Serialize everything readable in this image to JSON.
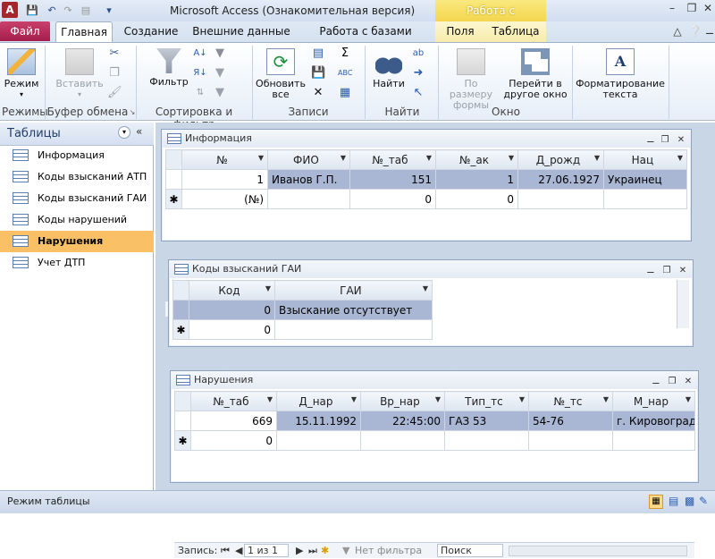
{
  "app": {
    "window_title": "Microsoft Access (Ознакомительная версия)",
    "context_group": "Работа с таблицами"
  },
  "ribbon_tabs": [
    "Файл",
    "Главная",
    "Создание",
    "Внешние данные",
    "Работа с базами данных",
    "Поля",
    "Таблица"
  ],
  "ribbon": {
    "views": {
      "mode": "Режим",
      "group": "Режимы"
    },
    "clipboard": {
      "paste": "Вставить",
      "group": "Буфер обмена"
    },
    "sort": {
      "filter": "Фильтр",
      "group": "Сортировка и фильтр"
    },
    "records": {
      "refresh_line1": "Обновить",
      "refresh_line2": "все",
      "group": "Записи"
    },
    "find": {
      "find": "Найти",
      "group": "Найти"
    },
    "window": {
      "fit_line1": "По размеру",
      "fit_line2": "формы",
      "switch_line1": "Перейти в",
      "switch_line2": "другое окно",
      "group": "Окно"
    },
    "text": {
      "format_line1": "Форматирование",
      "format_line2": "текста"
    }
  },
  "nav": {
    "title": "Таблицы",
    "items": [
      "Информация",
      "Коды взысканий АТП",
      "Коды взысканий ГАИ",
      "Коды нарушений",
      "Нарушения",
      "Учет ДТП"
    ],
    "selected": "Нарушения"
  },
  "recbar": {
    "label": "Запись:",
    "position": "1 из 1",
    "filter": "Нет фильтра",
    "search": "Поиск"
  },
  "tables": {
    "info": {
      "title": "Информация",
      "columns": [
        "№",
        "ФИО",
        "№_таб",
        "№_ак",
        "Д_рожд",
        "Нац"
      ],
      "row1": [
        "1",
        "Иванов Г.П.",
        "151",
        "1",
        "27.06.1927",
        "Украинец"
      ],
      "row_new": [
        "(№)",
        "",
        "0",
        "0",
        "",
        ""
      ]
    },
    "gai": {
      "title": "Коды взысканий ГАИ",
      "columns": [
        "Код",
        "ГАИ"
      ],
      "row1": [
        "0",
        "Взыскание отсутствует"
      ],
      "row_new": [
        "0",
        ""
      ]
    },
    "nar": {
      "title": "Нарушения",
      "columns": [
        "№_таб",
        "Д_нар",
        "Вр_нар",
        "Тип_тс",
        "№_тс",
        "М_нар"
      ],
      "row1": [
        "669",
        "15.11.1992",
        "22:45:00",
        "ГАЗ 53",
        "54-76",
        "г. Кировоград"
      ],
      "row_new": [
        "0",
        "",
        "",
        "",
        "",
        ""
      ]
    }
  },
  "status": {
    "text": "Режим таблицы"
  }
}
